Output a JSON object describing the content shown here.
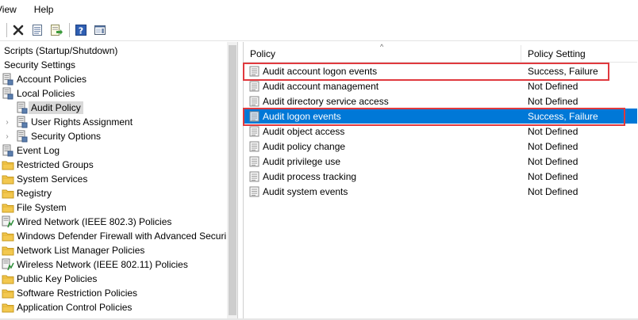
{
  "menu": {
    "items": [
      "View",
      "Help"
    ]
  },
  "toolbar": {
    "buttons": [
      {
        "icon": "delete-icon"
      },
      {
        "icon": "properties-icon"
      },
      {
        "icon": "export-list-icon"
      },
      {
        "icon": "help-icon"
      },
      {
        "icon": "show-hide-action-pane-icon"
      }
    ]
  },
  "tree": {
    "items": [
      {
        "label": "Scripts (Startup/Shutdown)",
        "icon": "none"
      },
      {
        "label": "Security Settings",
        "icon": "none"
      },
      {
        "label": "Account Policies",
        "icon": "policy-icon"
      },
      {
        "label": "Local Policies",
        "icon": "policy-icon"
      },
      {
        "label": "Audit Policy",
        "icon": "policy-icon",
        "selected": true
      },
      {
        "label": "User Rights Assignment",
        "icon": "policy-icon",
        "expander": true
      },
      {
        "label": "Security Options",
        "icon": "policy-icon",
        "expander": true
      },
      {
        "label": "Event Log",
        "icon": "policy-icon"
      },
      {
        "label": "Restricted Groups",
        "icon": "folder-icon"
      },
      {
        "label": "System Services",
        "icon": "folder-icon"
      },
      {
        "label": "Registry",
        "icon": "folder-icon"
      },
      {
        "label": "File System",
        "icon": "folder-icon"
      },
      {
        "label": "Wired Network (IEEE 802.3) Policies",
        "icon": "network-icon"
      },
      {
        "label": "Windows Defender Firewall with Advanced Securi",
        "icon": "folder-icon"
      },
      {
        "label": "Network List Manager Policies",
        "icon": "folder-icon"
      },
      {
        "label": "Wireless Network (IEEE 802.11) Policies",
        "icon": "network-icon"
      },
      {
        "label": "Public Key Policies",
        "icon": "folder-icon"
      },
      {
        "label": "Software Restriction Policies",
        "icon": "folder-icon"
      },
      {
        "label": "Application Control Policies",
        "icon": "folder-icon"
      }
    ]
  },
  "list": {
    "columns": [
      "Policy",
      "Policy Setting"
    ],
    "rows": [
      {
        "policy": "Audit account logon events",
        "setting": "Success, Failure",
        "highlight": true
      },
      {
        "policy": "Audit account management",
        "setting": "Not Defined"
      },
      {
        "policy": "Audit directory service access",
        "setting": "Not Defined"
      },
      {
        "policy": "Audit logon events",
        "setting": "Success, Failure",
        "highlight": true,
        "selected": true
      },
      {
        "policy": "Audit object access",
        "setting": "Not Defined"
      },
      {
        "policy": "Audit policy change",
        "setting": "Not Defined"
      },
      {
        "policy": "Audit privilege use",
        "setting": "Not Defined"
      },
      {
        "policy": "Audit process tracking",
        "setting": "Not Defined"
      },
      {
        "policy": "Audit system events",
        "setting": "Not Defined"
      }
    ]
  },
  "colors": {
    "selection": "#0078d7",
    "highlight_box": "#e0393e"
  }
}
